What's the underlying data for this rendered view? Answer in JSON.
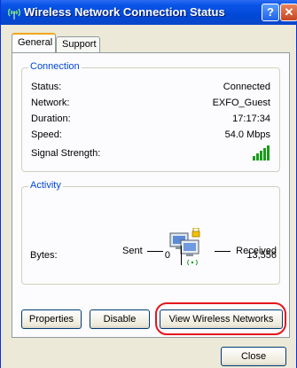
{
  "window": {
    "title": "Wireless Network Connection Status",
    "help_label": "?",
    "close_label": "✕"
  },
  "tabs": [
    {
      "label": "General"
    },
    {
      "label": "Support"
    }
  ],
  "connection": {
    "legend": "Connection",
    "rows": [
      {
        "label": "Status:",
        "value": "Connected"
      },
      {
        "label": "Network:",
        "value": "EXFO_Guest"
      },
      {
        "label": "Duration:",
        "value": "17:17:34"
      },
      {
        "label": "Speed:",
        "value": "54.0 Mbps"
      },
      {
        "label": "Signal Strength:",
        "value": ""
      }
    ],
    "signal_bars": 5
  },
  "activity": {
    "legend": "Activity",
    "sent_label": "Sent",
    "received_label": "Received",
    "bytes_label": "Bytes:",
    "bytes_sent": "0",
    "bytes_received": "13,556"
  },
  "buttons": {
    "properties": "Properties",
    "disable": "Disable",
    "view_networks": "View Wireless Networks",
    "close": "Close"
  },
  "colors": {
    "title_bar": "#0148d8",
    "legend_text": "#0046d5",
    "highlight": "#e3161b",
    "signal": "#1b9b1b"
  }
}
